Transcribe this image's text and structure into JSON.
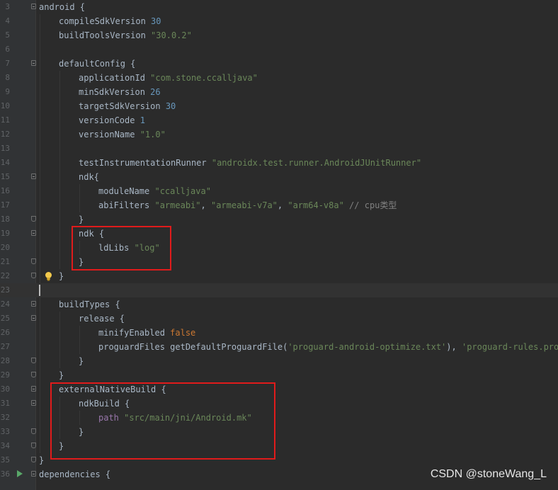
{
  "editor": {
    "lines": [
      {
        "n": "3",
        "fold": "open",
        "indent": 0,
        "tokens": [
          {
            "t": "android {",
            "c": ""
          }
        ]
      },
      {
        "n": "4",
        "indent": 1,
        "tokens": [
          {
            "t": "compileSdkVersion ",
            "c": ""
          },
          {
            "t": "30",
            "c": "num"
          }
        ]
      },
      {
        "n": "5",
        "indent": 1,
        "tokens": [
          {
            "t": "buildToolsVersion ",
            "c": ""
          },
          {
            "t": "\"30.0.2\"",
            "c": "str"
          }
        ]
      },
      {
        "n": "6",
        "indent": 1,
        "tokens": []
      },
      {
        "n": "7",
        "fold": "open",
        "indent": 1,
        "tokens": [
          {
            "t": "defaultConfig {",
            "c": ""
          }
        ]
      },
      {
        "n": "8",
        "indent": 2,
        "tokens": [
          {
            "t": "applicationId ",
            "c": ""
          },
          {
            "t": "\"com.stone.ccalljava\"",
            "c": "str"
          }
        ]
      },
      {
        "n": "9",
        "indent": 2,
        "tokens": [
          {
            "t": "minSdkVersion ",
            "c": ""
          },
          {
            "t": "26",
            "c": "num"
          }
        ]
      },
      {
        "n": "10",
        "indent": 2,
        "tokens": [
          {
            "t": "targetSdkVersion ",
            "c": ""
          },
          {
            "t": "30",
            "c": "num"
          }
        ]
      },
      {
        "n": "11",
        "indent": 2,
        "tokens": [
          {
            "t": "versionCode ",
            "c": ""
          },
          {
            "t": "1",
            "c": "num"
          }
        ]
      },
      {
        "n": "12",
        "indent": 2,
        "tokens": [
          {
            "t": "versionName ",
            "c": ""
          },
          {
            "t": "\"1.0\"",
            "c": "str"
          }
        ]
      },
      {
        "n": "13",
        "indent": 2,
        "tokens": []
      },
      {
        "n": "14",
        "indent": 2,
        "tokens": [
          {
            "t": "testInstrumentationRunner ",
            "c": ""
          },
          {
            "t": "\"androidx.test.runner.AndroidJUnitRunner\"",
            "c": "str"
          }
        ]
      },
      {
        "n": "15",
        "fold": "open",
        "indent": 2,
        "tokens": [
          {
            "t": "ndk{",
            "c": ""
          }
        ]
      },
      {
        "n": "16",
        "indent": 3,
        "tokens": [
          {
            "t": "moduleName ",
            "c": ""
          },
          {
            "t": "\"ccalljava\"",
            "c": "str"
          }
        ]
      },
      {
        "n": "17",
        "indent": 3,
        "tokens": [
          {
            "t": "abiFilters ",
            "c": ""
          },
          {
            "t": "\"armeabi\"",
            "c": "str"
          },
          {
            "t": ", ",
            "c": ""
          },
          {
            "t": "\"armeabi-v7a\"",
            "c": "str"
          },
          {
            "t": ", ",
            "c": ""
          },
          {
            "t": "\"arm64-v8a\"",
            "c": "str"
          },
          {
            "t": " // cpu类型",
            "c": "cmt"
          }
        ]
      },
      {
        "n": "18",
        "fold": "end",
        "indent": 2,
        "tokens": [
          {
            "t": "}",
            "c": ""
          }
        ]
      },
      {
        "n": "19",
        "fold": "open",
        "indent": 2,
        "tokens": [
          {
            "t": "ndk {",
            "c": ""
          }
        ]
      },
      {
        "n": "20",
        "indent": 3,
        "tokens": [
          {
            "t": "ldLibs ",
            "c": ""
          },
          {
            "t": "\"log\"",
            "c": "str"
          }
        ]
      },
      {
        "n": "21",
        "fold": "end",
        "indent": 2,
        "tokens": [
          {
            "t": "}",
            "c": ""
          }
        ]
      },
      {
        "n": "22",
        "fold": "end",
        "indent": 1,
        "bulb": true,
        "tokens": [
          {
            "t": "}",
            "c": ""
          }
        ]
      },
      {
        "n": "23",
        "indent": 0,
        "current": true,
        "tokens": []
      },
      {
        "n": "24",
        "fold": "open",
        "indent": 1,
        "tokens": [
          {
            "t": "buildTypes {",
            "c": ""
          }
        ]
      },
      {
        "n": "25",
        "fold": "open",
        "indent": 2,
        "tokens": [
          {
            "t": "release {",
            "c": ""
          }
        ]
      },
      {
        "n": "26",
        "indent": 3,
        "tokens": [
          {
            "t": "minifyEnabled ",
            "c": ""
          },
          {
            "t": "false",
            "c": "kw"
          }
        ]
      },
      {
        "n": "27",
        "indent": 3,
        "tokens": [
          {
            "t": "proguardFiles getDefaultProguardFile(",
            "c": ""
          },
          {
            "t": "'proguard-android-optimize.txt'",
            "c": "str"
          },
          {
            "t": "), ",
            "c": ""
          },
          {
            "t": "'proguard-rules.pro'",
            "c": "str"
          }
        ]
      },
      {
        "n": "28",
        "fold": "end",
        "indent": 2,
        "tokens": [
          {
            "t": "}",
            "c": ""
          }
        ]
      },
      {
        "n": "29",
        "fold": "end",
        "indent": 1,
        "tokens": [
          {
            "t": "}",
            "c": ""
          }
        ]
      },
      {
        "n": "30",
        "fold": "open",
        "indent": 1,
        "tokens": [
          {
            "t": "externalNativeBuild {",
            "c": ""
          }
        ]
      },
      {
        "n": "31",
        "fold": "open",
        "indent": 2,
        "tokens": [
          {
            "t": "ndkBuild {",
            "c": ""
          }
        ]
      },
      {
        "n": "32",
        "indent": 3,
        "tokens": [
          {
            "t": "path ",
            "c": "prop"
          },
          {
            "t": "\"src/main/jni/Android.mk\"",
            "c": "str"
          }
        ]
      },
      {
        "n": "33",
        "fold": "end",
        "indent": 2,
        "tokens": [
          {
            "t": "}",
            "c": ""
          }
        ]
      },
      {
        "n": "34",
        "fold": "end",
        "indent": 1,
        "tokens": [
          {
            "t": "}",
            "c": ""
          }
        ]
      },
      {
        "n": "35",
        "fold": "end",
        "indent": 0,
        "tokens": [
          {
            "t": "}",
            "c": ""
          }
        ]
      },
      {
        "n": "36",
        "indent": 0,
        "run": true,
        "fold": "open",
        "tokens": [
          {
            "t": "dependencies {",
            "c": ""
          }
        ]
      }
    ]
  },
  "watermark": "CSDN @stoneWang_L",
  "colors": {
    "background": "#2b2b2b",
    "highlight_box": "#e01b1b"
  }
}
